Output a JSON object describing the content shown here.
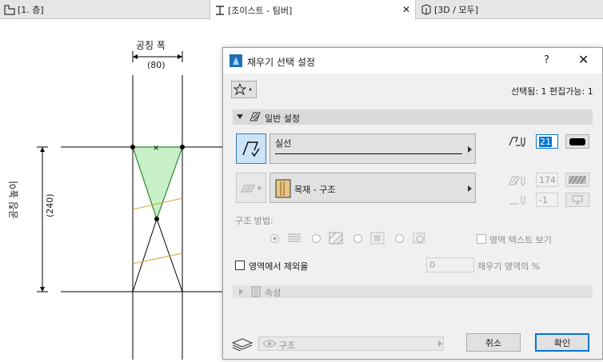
{
  "tabs": [
    {
      "label": "[1. 층]"
    },
    {
      "label": "[조이스트 - 팀버]",
      "close": "✕"
    },
    {
      "label": "[3D / 모두]"
    }
  ],
  "drawing": {
    "width_label": "공칭 폭",
    "width_value": "(80)",
    "height_label": "공칭 높이",
    "height_value": "(240)"
  },
  "dialog": {
    "title": "채우기 선택 설정",
    "help": "?",
    "selection_status": "선택됨: 1 편집가능: 1",
    "general_section": "일반 설정",
    "line_type": "실선",
    "pen_number": "21",
    "material": "목재 - 구조",
    "bg_pen": "174",
    "bg_pen2": "-1",
    "structure_method_label": "구조 방법:",
    "show_area_text": "영역 텍스트 보기",
    "exclude_from_area": "영역에서 제외율",
    "area_percent_value": "0",
    "area_percent_label": "채우기 영역의 %",
    "properties_section": "속성",
    "layer": "구조",
    "cancel": "취소",
    "ok": "확인"
  },
  "colors": {
    "accent": "#0078d7",
    "fill_green": "#c8f0c8",
    "fill_outline": "#2a8a2a",
    "hatch_orange": "#d4a03a"
  }
}
